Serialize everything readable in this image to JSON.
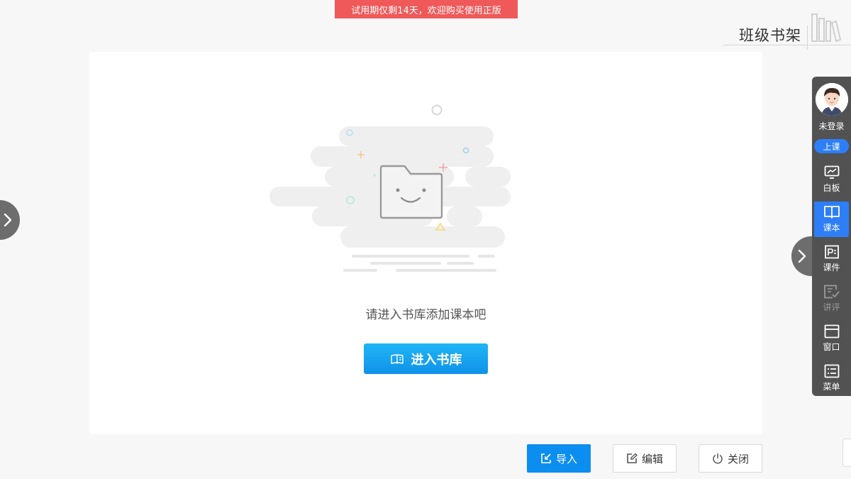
{
  "trial_banner": "试用期仅剩14天，欢迎购买使用正版",
  "header": {
    "title": "班级书架"
  },
  "empty_state": {
    "message": "请进入书库添加课本吧",
    "button_label": "进入书库"
  },
  "toolbar": {
    "login_status": "未登录",
    "class_button": "上课",
    "items": [
      {
        "label": "白板",
        "icon": "whiteboard-icon",
        "state": "normal"
      },
      {
        "label": "课本",
        "icon": "book-icon",
        "state": "active"
      },
      {
        "label": "课件",
        "icon": "courseware-icon",
        "state": "normal"
      },
      {
        "label": "讲评",
        "icon": "review-icon",
        "state": "disabled"
      },
      {
        "label": "窗口",
        "icon": "window-icon",
        "state": "normal"
      },
      {
        "label": "菜单",
        "icon": "menu-icon",
        "state": "normal"
      }
    ]
  },
  "bottom_buttons": {
    "import": "导入",
    "edit": "编辑",
    "close": "关闭"
  },
  "colors": {
    "accent_blue": "#0c8ef0",
    "active_blue": "#2d7ef7",
    "trial_red": "#ef5959",
    "toolbar_bg": "#525252"
  }
}
